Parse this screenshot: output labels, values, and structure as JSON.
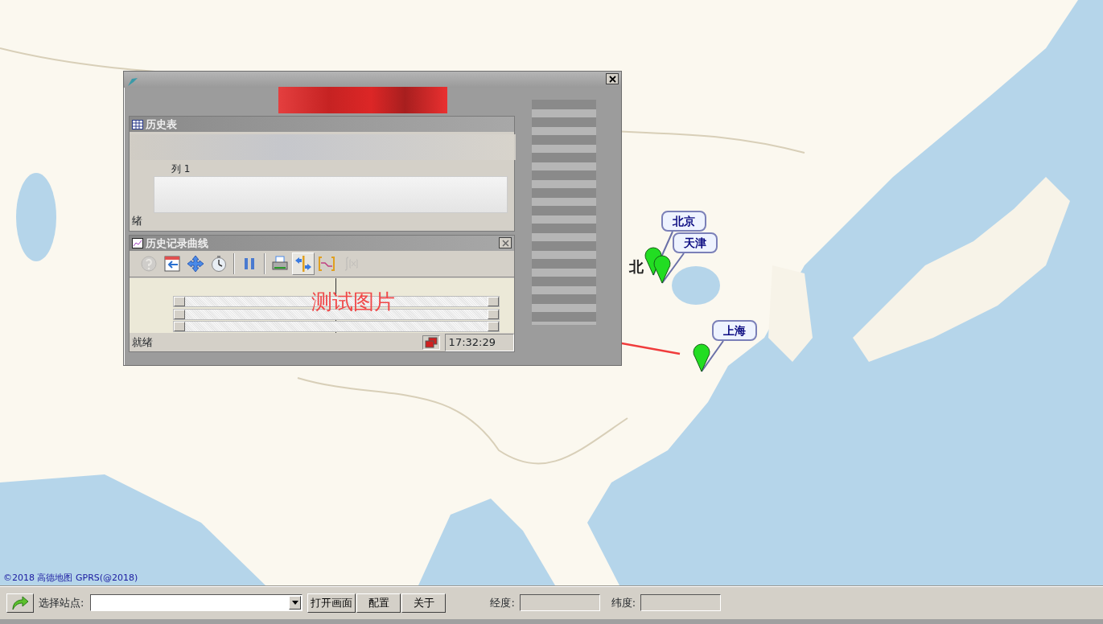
{
  "map": {
    "attribution": "©2018 高德地图 GPRS(@2018)",
    "place_label": "北",
    "markers": [
      {
        "label": "北京"
      },
      {
        "label": "天津"
      },
      {
        "label": "上海"
      }
    ]
  },
  "window": {
    "upper_panel": {
      "title": "历史表",
      "column_header": "列 1",
      "status": "绪"
    },
    "lower_panel": {
      "title": "历史记录曲线",
      "toolbar": [
        {
          "kind": "help",
          "disabled": true,
          "pressed": false
        },
        {
          "kind": "calendar",
          "disabled": false,
          "pressed": false
        },
        {
          "kind": "move",
          "disabled": false,
          "pressed": false
        },
        {
          "kind": "timer",
          "disabled": false,
          "pressed": false
        },
        {
          "kind": "separator"
        },
        {
          "kind": "pause",
          "disabled": false,
          "pressed": false
        },
        {
          "kind": "separator"
        },
        {
          "kind": "print",
          "disabled": false,
          "pressed": false
        },
        {
          "kind": "cursor",
          "disabled": false,
          "pressed": true
        },
        {
          "kind": "range",
          "disabled": false,
          "pressed": false
        },
        {
          "kind": "function",
          "disabled": true,
          "pressed": false
        }
      ],
      "chart_text": "测试图片",
      "status": "就绪",
      "time": "17:32:29"
    }
  },
  "toolbar": {
    "station_label": "选择站点:",
    "buttons": [
      "打开画面",
      "配置",
      "关于"
    ],
    "longitude_label": "经度:",
    "latitude_label": "纬度:"
  }
}
